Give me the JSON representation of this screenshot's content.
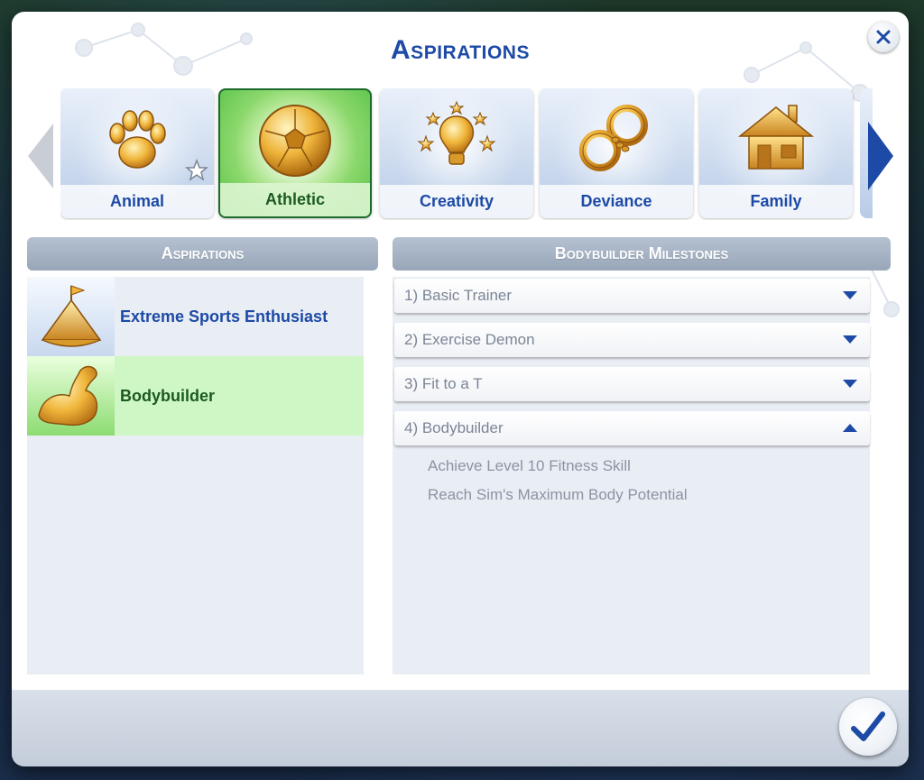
{
  "dialog": {
    "title": "Aspirations"
  },
  "carousel": {
    "tiles": [
      {
        "label": "Animal",
        "icon": "paw-icon",
        "favorited": false
      },
      {
        "label": "Athletic",
        "icon": "soccer-ball-icon",
        "selected": true
      },
      {
        "label": "Creativity",
        "icon": "lightbulb-icon"
      },
      {
        "label": "Deviance",
        "icon": "handcuffs-icon"
      },
      {
        "label": "Family",
        "icon": "house-icon"
      }
    ]
  },
  "aspirations_panel": {
    "header": "Aspirations",
    "items": [
      {
        "name": "Extreme Sports Enthusiast",
        "icon": "mountain-flag-icon"
      },
      {
        "name": "Bodybuilder",
        "icon": "flexed-arm-icon",
        "selected": true
      }
    ]
  },
  "milestones_panel": {
    "header": "Bodybuilder Milestones",
    "milestones": [
      {
        "label": "1) Basic Trainer",
        "expanded": false
      },
      {
        "label": "2) Exercise Demon",
        "expanded": false
      },
      {
        "label": "3) Fit to a T",
        "expanded": false
      },
      {
        "label": "4) Bodybuilder",
        "expanded": true
      }
    ],
    "objectives": [
      "Achieve Level 10 Fitness Skill",
      "Reach Sim's Maximum Body Potential"
    ]
  },
  "colors": {
    "title_blue": "#1d4aa6",
    "selected_green": "#cff7c6",
    "gold": "#e0a52a"
  }
}
